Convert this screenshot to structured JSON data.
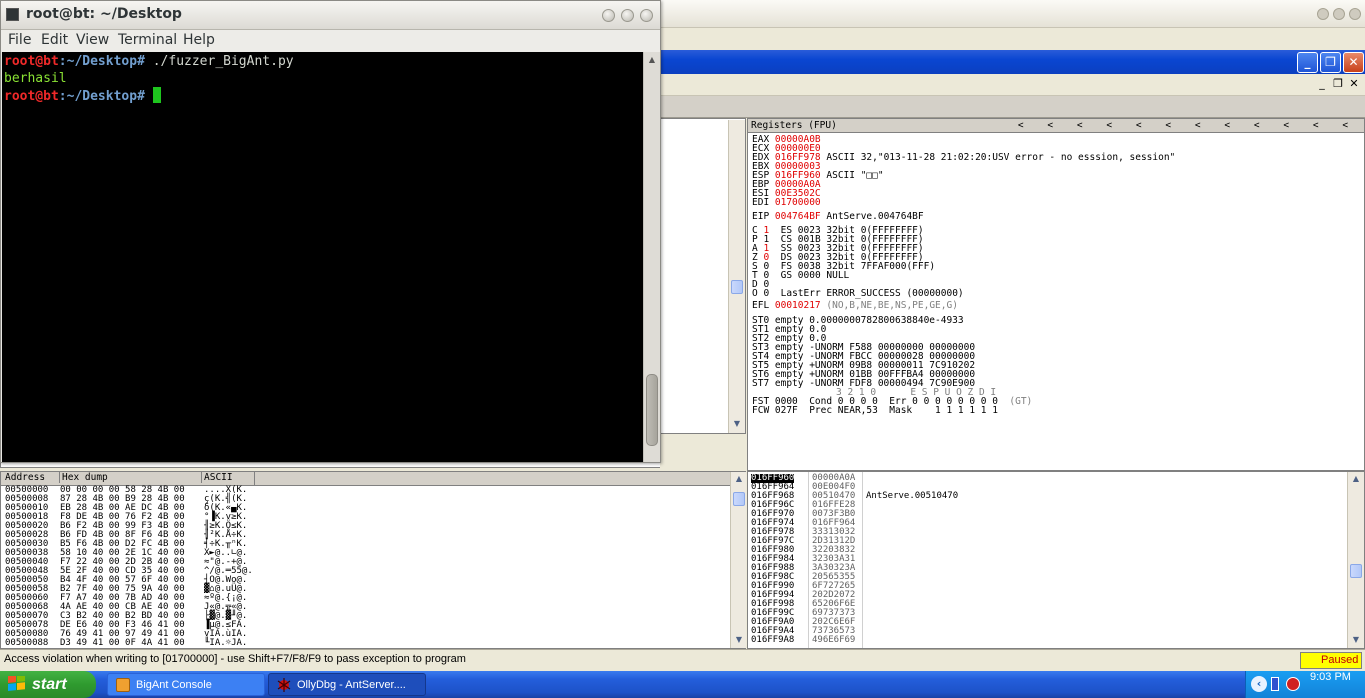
{
  "terminal": {
    "title": "root@bt: ~/Desktop",
    "menu": [
      "File",
      "Edit",
      "View",
      "Terminal",
      "Help"
    ],
    "lines": [
      {
        "user": "root@bt",
        "path": ":~/Desktop#",
        "cmd": " ./fuzzer_BigAnt.py"
      },
      {
        "output": "berhasil"
      },
      {
        "user": "root@bt",
        "path": ":~/Desktop#",
        "cmd": " "
      }
    ]
  },
  "registers": {
    "header": "Registers (FPU)",
    "arrows": [
      "<",
      "<",
      "<",
      "<",
      "<",
      "<",
      "<",
      "<",
      "<",
      "<",
      "<",
      "<"
    ],
    "gp": [
      {
        "name": "EAX",
        "value": "00000A0B",
        "comment": ""
      },
      {
        "name": "ECX",
        "value": "000000E0",
        "comment": ""
      },
      {
        "name": "EDX",
        "value": "016FF978",
        "comment": "ASCII 32,\"013-11-28 21:02:20:USV error - no esssion, session\""
      },
      {
        "name": "EBX",
        "value": "00000003",
        "comment": ""
      },
      {
        "name": "ESP",
        "value": "016FF960",
        "comment": "ASCII \"□□\""
      },
      {
        "name": "EBP",
        "value": "00000A0A",
        "comment": ""
      },
      {
        "name": "ESI",
        "value": "00E3502C",
        "comment": ""
      },
      {
        "name": "EDI",
        "value": "01700000",
        "comment": ""
      }
    ],
    "eip": {
      "name": "EIP",
      "value": "004764BF",
      "comment": "AntServe.004764BF"
    },
    "flags": [
      {
        "f": "C",
        "v": "1",
        "red": true,
        "seg": "ES 0023 32bit 0(FFFFFFFF)"
      },
      {
        "f": "P",
        "v": "1",
        "red": false,
        "seg": "CS 001B 32bit 0(FFFFFFFF)"
      },
      {
        "f": "A",
        "v": "1",
        "red": true,
        "seg": "SS 0023 32bit 0(FFFFFFFF)"
      },
      {
        "f": "Z",
        "v": "0",
        "red": true,
        "seg": "DS 0023 32bit 0(FFFFFFFF)"
      },
      {
        "f": "S",
        "v": "0",
        "red": false,
        "seg": "FS 0038 32bit 7FFAF000(FFF)"
      },
      {
        "f": "T",
        "v": "0",
        "red": false,
        "seg": "GS 0000 NULL"
      },
      {
        "f": "D",
        "v": "0",
        "red": false,
        "seg": ""
      },
      {
        "f": "O",
        "v": "0",
        "red": false,
        "seg": "LastErr ERROR_SUCCESS (00000000)"
      }
    ],
    "efl": {
      "name": "EFL",
      "value": "00010217",
      "comment": "(NO,B,NE,BE,NS,PE,GE,G)"
    },
    "fpu": [
      "ST0 empty 0.0000000782800638840e-4933",
      "ST1 empty 0.0",
      "ST2 empty 0.0",
      "ST3 empty -UNORM F588 00000000 00000000",
      "ST4 empty -UNORM FBCC 00000028 00000000",
      "ST5 empty +UNORM 09B8 00000011 7C910202",
      "ST6 empty +UNORM 01BB 00FFFBA4 00000000",
      "ST7 empty -UNORM FDF8 00000494 7C90E900"
    ],
    "fst_bits_label": "3 2 1 0      E S P U O Z D I",
    "fst": "FST 0000  Cond 0 0 0 0  Err 0 0 0 0 0 0 0 0",
    "fst_tail": "(GT)",
    "fcw": "FCW 027F  Prec NEAR,53  Mask    1 1 1 1 1 1"
  },
  "dump": {
    "headers": {
      "address": "Address",
      "hex": "Hex dump",
      "ascii": "ASCII"
    },
    "rows": [
      {
        "addr": "00500000",
        "hex": "00 00 00 00 58 28 4B 00",
        "ascii": "....X(K."
      },
      {
        "addr": "00500008",
        "hex": "87 28 4B 00 B9 28 4B 00",
        "ascii": "ç(K.╣(K."
      },
      {
        "addr": "00500010",
        "hex": "EB 28 4B 00 AE DC 4B 00",
        "ascii": "δ(K.«▄K."
      },
      {
        "addr": "00500018",
        "hex": "F8 DE 4B 00 76 F2 4B 00",
        "ascii": "°▐K.v≥K."
      },
      {
        "addr": "00500020",
        "hex": "B6 F2 4B 00 99 F3 4B 00",
        "ascii": "╢≥K.Ö≤K."
      },
      {
        "addr": "00500028",
        "hex": "B6 FD 4B 00 8F F6 4B 00",
        "ascii": "╢²K.Å÷K."
      },
      {
        "addr": "00500030",
        "hex": "B5 F6 4B 00 D2 FC 4B 00",
        "ascii": "╡÷K.╥ⁿK."
      },
      {
        "addr": "00500038",
        "hex": "58 10 40 00 2E 1C 40 00",
        "ascii": "X►@..∟@."
      },
      {
        "addr": "00500040",
        "hex": "F7 22 40 00 2D 2B 40 00",
        "ascii": "≈\"@.-+@."
      },
      {
        "addr": "00500048",
        "hex": "5E 2F 40 00 CD 35 40 00",
        "ascii": "^/@.═55@."
      },
      {
        "addr": "00500050",
        "hex": "B4 4F 40 00 57 6F 40 00",
        "ascii": "┤O@.Wo@."
      },
      {
        "addr": "00500058",
        "hex": "B2 7F 40 00 75 9A 40 00",
        "ascii": "▓⌂@.uÜ@."
      },
      {
        "addr": "00500060",
        "hex": "F7 A7 40 00 7B AD 40 00",
        "ascii": "≈º@.{¡@."
      },
      {
        "addr": "00500068",
        "hex": "4A AE 40 00 CB AE 40 00",
        "ascii": "J«@.╦«@."
      },
      {
        "addr": "00500070",
        "hex": "C3 B2 40 00 B2 BD 40 00",
        "ascii": "├▓@.▓╜@."
      },
      {
        "addr": "00500078",
        "hex": "DE E6 40 00 F3 46 41 00",
        "ascii": "▐µ@.≤FA."
      },
      {
        "addr": "00500080",
        "hex": "76 49 41 00 97 49 41 00",
        "ascii": "vIA.ùIA."
      },
      {
        "addr": "00500088",
        "hex": "D3 49 41 00 0F 4A 41 00",
        "ascii": "╙IA.☼JA."
      }
    ]
  },
  "stack": {
    "rows": [
      {
        "addr": "016FF960",
        "val": "00000A0A",
        "comment": "",
        "selected": true
      },
      {
        "addr": "016FF964",
        "val": "00E004F0",
        "comment": ""
      },
      {
        "addr": "016FF968",
        "val": "00510470",
        "comment": "AntServe.00510470"
      },
      {
        "addr": "016FF96C",
        "val": "016FFE28",
        "comment": ""
      },
      {
        "addr": "016FF970",
        "val": "0073F3B0",
        "comment": ""
      },
      {
        "addr": "016FF974",
        "val": "016FF964",
        "comment": ""
      },
      {
        "addr": "016FF978",
        "val": "33313032",
        "comment": ""
      },
      {
        "addr": "016FF97C",
        "val": "2D31312D",
        "comment": ""
      },
      {
        "addr": "016FF980",
        "val": "32203832",
        "comment": ""
      },
      {
        "addr": "016FF984",
        "val": "32303A31",
        "comment": ""
      },
      {
        "addr": "016FF988",
        "val": "3A30323A",
        "comment": ""
      },
      {
        "addr": "016FF98C",
        "val": "20565355",
        "comment": ""
      },
      {
        "addr": "016FF990",
        "val": "6F727265",
        "comment": ""
      },
      {
        "addr": "016FF994",
        "val": "202D2072",
        "comment": ""
      },
      {
        "addr": "016FF998",
        "val": "65206F6E",
        "comment": ""
      },
      {
        "addr": "016FF99C",
        "val": "69737373",
        "comment": ""
      },
      {
        "addr": "016FF9A0",
        "val": "202C6E6F",
        "comment": ""
      },
      {
        "addr": "016FF9A4",
        "val": "73736573",
        "comment": ""
      },
      {
        "addr": "016FF9A8",
        "val": "496E6F69",
        "comment": ""
      }
    ]
  },
  "statusbar": {
    "message": "Access violation when writing to [01700000] - use Shift+F7/F8/F9 to pass exception to program",
    "state": "Paused",
    "state_bg": "#ffff00",
    "state_fg": "#c00000"
  },
  "taskbar": {
    "start": "start",
    "tasks": [
      {
        "label": "BigAnt Console",
        "icon": "bigant-console-icon"
      },
      {
        "label": "OllyDbg - AntServer....",
        "icon": "ollydbg-icon"
      }
    ],
    "time": "9:03 PM"
  },
  "colors": {
    "reg_changed": "#e00000",
    "xp_title_blue": "#0a46d1",
    "taskbar_blue": "#245edb",
    "terminal_bg": "#000000",
    "prompt_user": "#ef2929",
    "prompt_path": "#729fcf",
    "output_green": "#8ae234",
    "cursor_green": "#1ec51e"
  }
}
